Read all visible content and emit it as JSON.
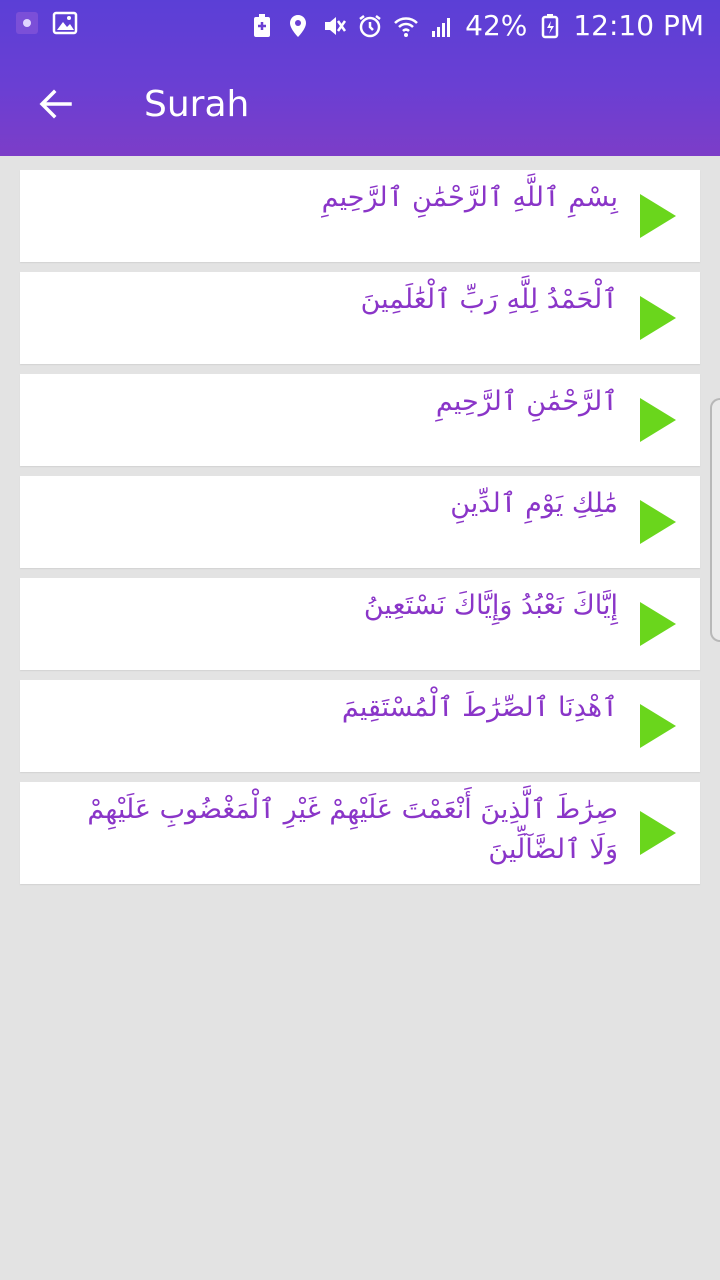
{
  "status_bar": {
    "battery_percent": "42%",
    "time": "12:10 PM"
  },
  "toolbar": {
    "title": "Surah"
  },
  "colors": {
    "header_top": "#5b3fd6",
    "header_bottom": "#7c3dc8",
    "verse_text": "#8a35c8",
    "play_icon": "#6ad61c",
    "background": "#e3e3e3"
  },
  "verses": [
    {
      "text": "بِسْمِ ٱللَّهِ ٱلرَّحْمَٰنِ ٱلرَّحِيمِ"
    },
    {
      "text": "ٱلْحَمْدُ لِلَّهِ رَبِّ ٱلْعَٰلَمِينَ"
    },
    {
      "text": "ٱلرَّحْمَٰنِ ٱلرَّحِيمِ"
    },
    {
      "text": "مَٰلِكِ يَوْمِ ٱلدِّينِ"
    },
    {
      "text": "إِيَّاكَ نَعْبُدُ وَإِيَّاكَ نَسْتَعِينُ"
    },
    {
      "text": "ٱهْدِنَا ٱلصِّرَٰطَ ٱلْمُسْتَقِيمَ"
    },
    {
      "text": "صِرَٰطَ ٱلَّذِينَ أَنْعَمْتَ عَلَيْهِمْ غَيْرِ ٱلْمَغْضُوبِ عَلَيْهِمْ وَلَا ٱلضَّآلِّينَ"
    }
  ]
}
